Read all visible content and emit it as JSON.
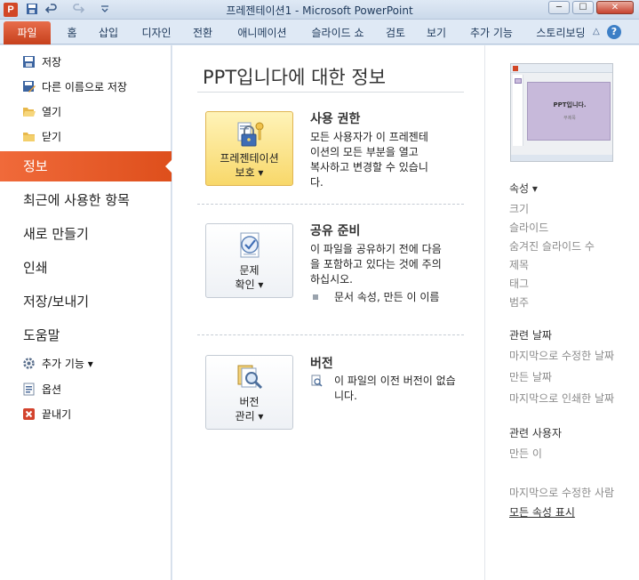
{
  "window": {
    "title": "프레젠테이션1  -  Microsoft PowerPoint",
    "app_icon": "P",
    "quick_access": {
      "save_icon": "save-icon",
      "undo_icon": "undo-icon",
      "redo_icon": "redo-icon",
      "customize_icon": "customize-icon"
    },
    "controls": {
      "minimize": "─",
      "maximize": "☐",
      "close": "✕"
    }
  },
  "ribbon": {
    "tabs": [
      "파일",
      "홈",
      "삽입",
      "디자인",
      "전환",
      "애니메이션",
      "슬라이드 쇼",
      "검토",
      "보기",
      "추가 기능",
      "스토리보딩"
    ],
    "help": "?",
    "minimize_ribbon": "△",
    "file_color": "#d9532b"
  },
  "nav": {
    "top_items": [
      {
        "label": "저장",
        "icon": "save-icon"
      },
      {
        "label": "다른 이름으로 저장",
        "icon": "save-as-icon"
      },
      {
        "label": "열기",
        "icon": "open-folder-icon"
      },
      {
        "label": "닫기",
        "icon": "close-folder-icon"
      }
    ],
    "big_items": [
      "정보",
      "최근에 사용한 항목",
      "새로 만들기",
      "인쇄",
      "저장/보내기",
      "도움말"
    ],
    "active": "정보",
    "bottom_items": [
      {
        "label": "추가 기능 ▾",
        "icon": "addins-icon"
      },
      {
        "label": "옵션",
        "icon": "options-icon"
      },
      {
        "label": "끝내기",
        "icon": "exit-icon"
      }
    ]
  },
  "main": {
    "title": "PPT입니다에 대한 정보",
    "permissions": {
      "button_line1": "프레젠테이션",
      "button_line2": "보호 ▾",
      "heading": "사용 권한",
      "text": "모든 사용자가 이 프레젠테이션의 모든 부분을 열고 복사하고 변경할 수 있습니다."
    },
    "prepare": {
      "button_line1": "문제",
      "button_line2": "확인 ▾",
      "heading": "공유 준비",
      "text": "이 파일을 공유하기 전에 다음을 포함하고 있다는 것에 주의하십시오.",
      "bullet": "문서 속성, 만든 이 이름"
    },
    "versions": {
      "button_line1": "버전",
      "button_line2": "관리 ▾",
      "heading": "버전",
      "text": "이 파일의 이전 버전이 없습니다."
    }
  },
  "right": {
    "thumbnail": {
      "slide_title": "PPT입니다.",
      "slide_subtitle": "부제목"
    },
    "properties_header": "속성 ▾",
    "properties": [
      "크기",
      "슬라이드",
      "숨겨진 슬라이드 수",
      "제목",
      "태그",
      "범주"
    ],
    "dates_header": "관련 날짜",
    "dates": [
      "마지막으로 수정한 날짜",
      "만든 날짜",
      "마지막으로 인쇄한 날짜"
    ],
    "people_header": "관련 사용자",
    "people": [
      "만든 이",
      "마지막으로 수정한 사람"
    ],
    "show_all": "모든 속성 표시"
  }
}
